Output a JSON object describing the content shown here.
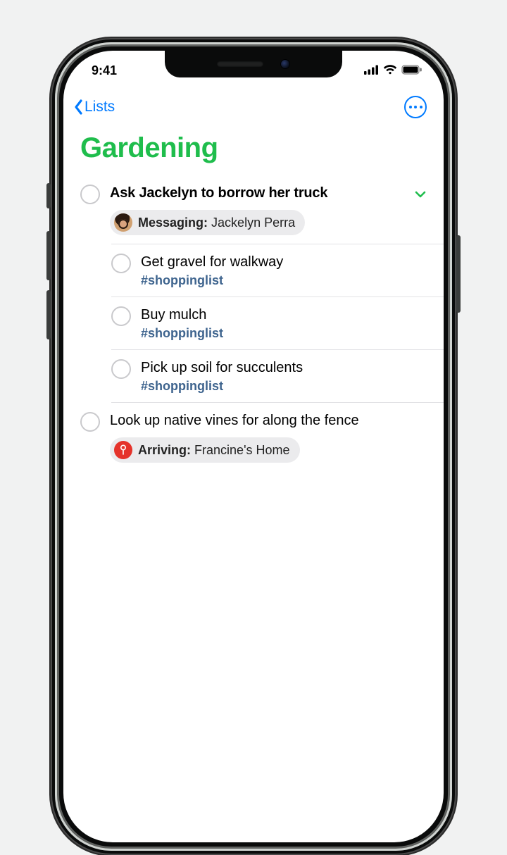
{
  "status": {
    "time": "9:41"
  },
  "nav": {
    "back_label": "Lists"
  },
  "page": {
    "title": "Gardening"
  },
  "colors": {
    "accent_green": "#1fbd4c",
    "ios_blue": "#007aff",
    "tag_blue": "#3e648e",
    "pin_red": "#e5332b"
  },
  "reminders": [
    {
      "title": "Ask Jackelyn to borrow her truck",
      "expanded": true,
      "chip": {
        "type": "messaging",
        "label": "Messaging:",
        "value": "Jackelyn Perra"
      },
      "subtasks": [
        {
          "title": "Get gravel for walkway",
          "tag": "#shoppinglist"
        },
        {
          "title": "Buy mulch",
          "tag": "#shoppinglist"
        },
        {
          "title": "Pick up soil for succulents",
          "tag": "#shoppinglist"
        }
      ]
    },
    {
      "title": "Look up native vines for along the fence",
      "chip": {
        "type": "location",
        "label": "Arriving:",
        "value": "Francine's Home"
      }
    }
  ]
}
